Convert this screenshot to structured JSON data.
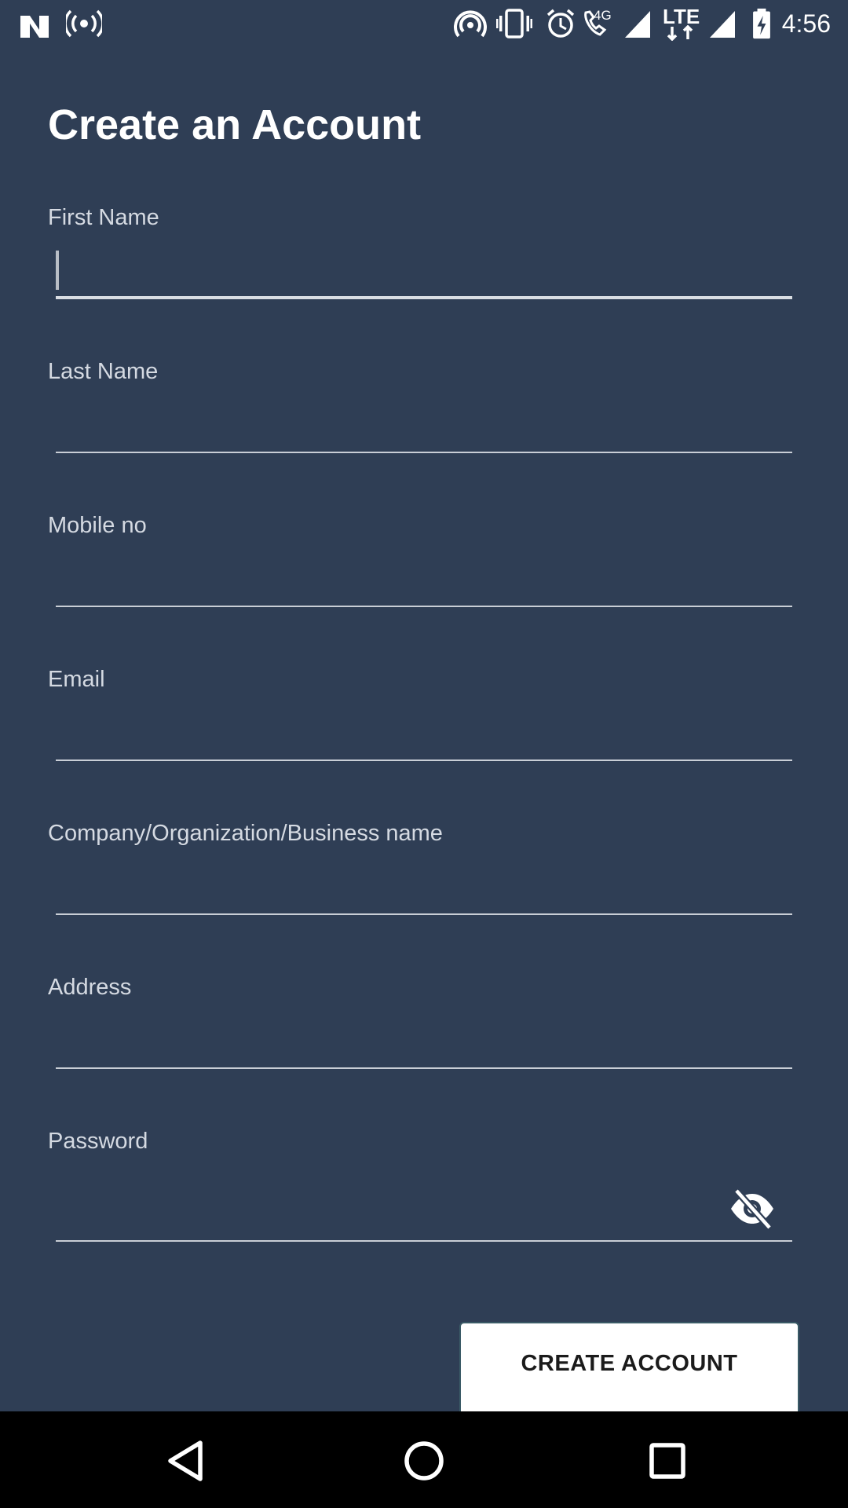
{
  "status_bar": {
    "time": "4:56",
    "icons": [
      "n-logo-icon",
      "hotspot-broadcast-icon",
      "wifi-hotspot-icon",
      "vibrate-icon",
      "alarm-icon",
      "wifi-calling-4g-icon",
      "signal-icon",
      "lte-data-icon",
      "signal-icon",
      "battery-charging-icon"
    ],
    "network_label": "LTE",
    "call_label": "4G"
  },
  "page": {
    "title": "Create an Account"
  },
  "form": {
    "fields": [
      {
        "label": "First Name",
        "value": "",
        "placeholder": ""
      },
      {
        "label": "Last Name",
        "value": "",
        "placeholder": ""
      },
      {
        "label": "Mobile no",
        "value": "",
        "placeholder": ""
      },
      {
        "label": "Email",
        "value": "",
        "placeholder": ""
      },
      {
        "label": "Company/Organization/Business name",
        "value": "",
        "placeholder": ""
      },
      {
        "label": "Address",
        "value": "",
        "placeholder": ""
      },
      {
        "label": "Password",
        "value": "",
        "placeholder": ""
      }
    ],
    "password_toggle_icon": "eye-off-icon",
    "submit_label": "CREATE ACCOUNT"
  },
  "nav_bar": {
    "buttons": [
      "back-icon",
      "home-icon",
      "recents-icon"
    ]
  },
  "colors": {
    "background": "#2f3e55",
    "text": "#ffffff",
    "label": "#d5dae2",
    "underline": "#c9ced6",
    "button_bg": "#ffffff",
    "button_text": "#1b1b1b",
    "nav_bar": "#000000"
  }
}
